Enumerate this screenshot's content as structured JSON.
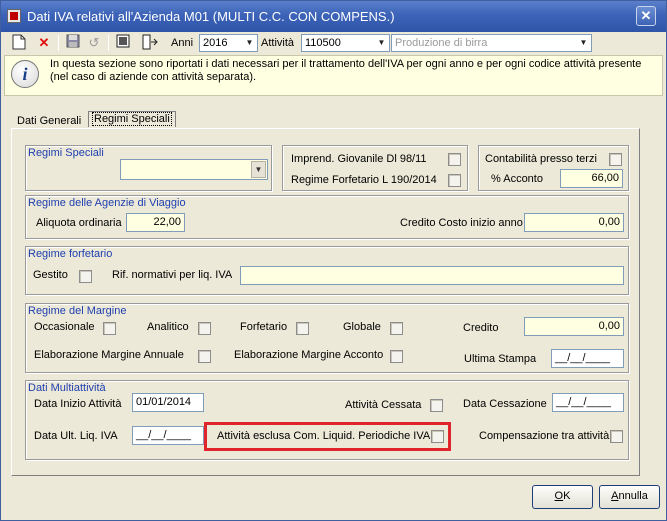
{
  "window": {
    "title": "Dati IVA relativi all'Azienda M01 (MULTI C.C. CON COMPENS.)",
    "close_glyph": "✕"
  },
  "toolbar": {
    "anni_label": "Anni",
    "anni_value": "2016",
    "attivita_label": "Attività",
    "attivita_value": "110500",
    "attivita_desc": "Produzione di birra"
  },
  "info": {
    "text": "In questa sezione sono riportati i dati necessari per il trattamento dell'IVA per ogni anno e per ogni codice attività presente (nel caso di aziende con attività separata)."
  },
  "tabs": [
    {
      "label": "Dati Generali"
    },
    {
      "label": "Regimi Speciali"
    }
  ],
  "regimi_speciali": {
    "title": "Regimi Speciali",
    "imprend_giovanile": "Imprend. Giovanile Dl 98/11",
    "regime_forfetario": "Regime Forfetario L 190/2014",
    "contabilita_terzi": "Contabilità presso terzi",
    "acconto_label": "% Acconto",
    "acconto_value": "66,00"
  },
  "agenzie_viaggio": {
    "title": "Regime delle Agenzie di Viaggio",
    "aliquota_label": "Aliquota ordinaria",
    "aliquota_value": "22,00",
    "credito_label": "Credito Costo inizio anno",
    "credito_value": "0,00"
  },
  "forfetario": {
    "title": "Regime forfetario",
    "gestito_label": "Gestito",
    "rif_label": "Rif. normativi per liq. IVA",
    "rif_value": ""
  },
  "margine": {
    "title": "Regime del Margine",
    "occasionale": "Occasionale",
    "analitico": "Analitico",
    "forfetario": "Forfetario",
    "globale": "Globale",
    "credito_label": "Credito",
    "credito_value": "0,00",
    "elab_annuale": "Elaborazione Margine Annuale",
    "elab_acconto": "Elaborazione Margine Acconto",
    "ultima_stampa_label": "Ultima Stampa",
    "ultima_stampa_value": "__/__/____"
  },
  "multiattivita": {
    "title": "Dati Multiattività",
    "data_inizio_label": "Data Inizio Attività",
    "data_inizio_value": "01/01/2014",
    "attivita_cessata": "Attività Cessata",
    "data_cessazione_label": "Data Cessazione",
    "data_cessazione_value": "__/__/____",
    "data_ult_liq_label": "Data Ult. Liq. IVA",
    "data_ult_liq_value": "__/__/____",
    "esclusa_label": "Attività esclusa Com. Liquid. Periodiche IVA",
    "compensazione_label": "Compensazione tra attività"
  },
  "buttons": {
    "ok_hot": "O",
    "ok_rest": "K",
    "annulla_hot": "A",
    "annulla_rest": "nnulla"
  },
  "colors": {
    "group_title": "#1f3fb0",
    "highlight": "#e0242c",
    "field_bg": "#ffffe1"
  }
}
